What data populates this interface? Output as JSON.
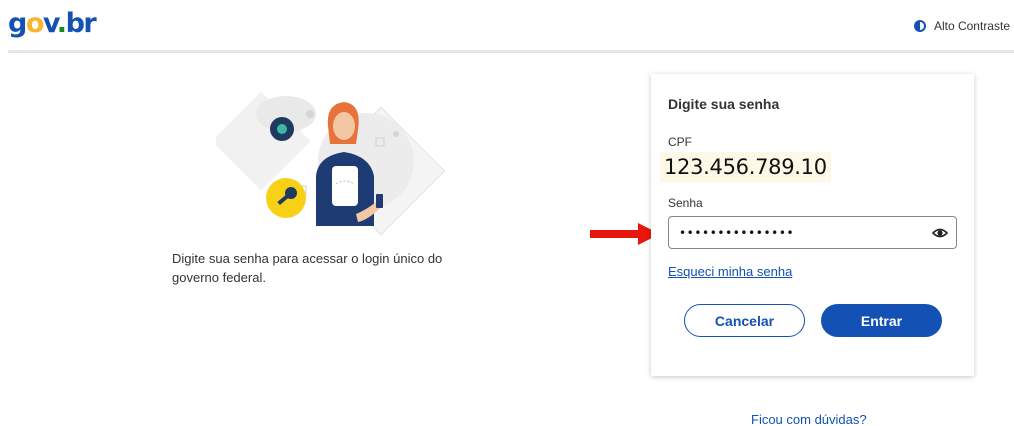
{
  "header": {
    "logo": {
      "g": "g",
      "o": "o",
      "v": "v",
      "dot": ".",
      "br": "br"
    },
    "contrast_label": "Alto Contraste"
  },
  "intro": {
    "text": "Digite sua senha para acessar o login único do governo federal."
  },
  "card": {
    "title": "Digite sua senha",
    "cpf_label": "CPF",
    "cpf_value": "123.456.789.10",
    "password_label": "Senha",
    "password_value": "•••••••••••••••",
    "forgot_link": "Esqueci minha senha",
    "cancel_label": "Cancelar",
    "enter_label": "Entrar"
  },
  "help_link": "Ficou com dúvidas?",
  "colors": {
    "primary": "#1351b4",
    "arrow": "#e8160c",
    "key_badge": "#f8d116",
    "hair": "#e8733a"
  }
}
